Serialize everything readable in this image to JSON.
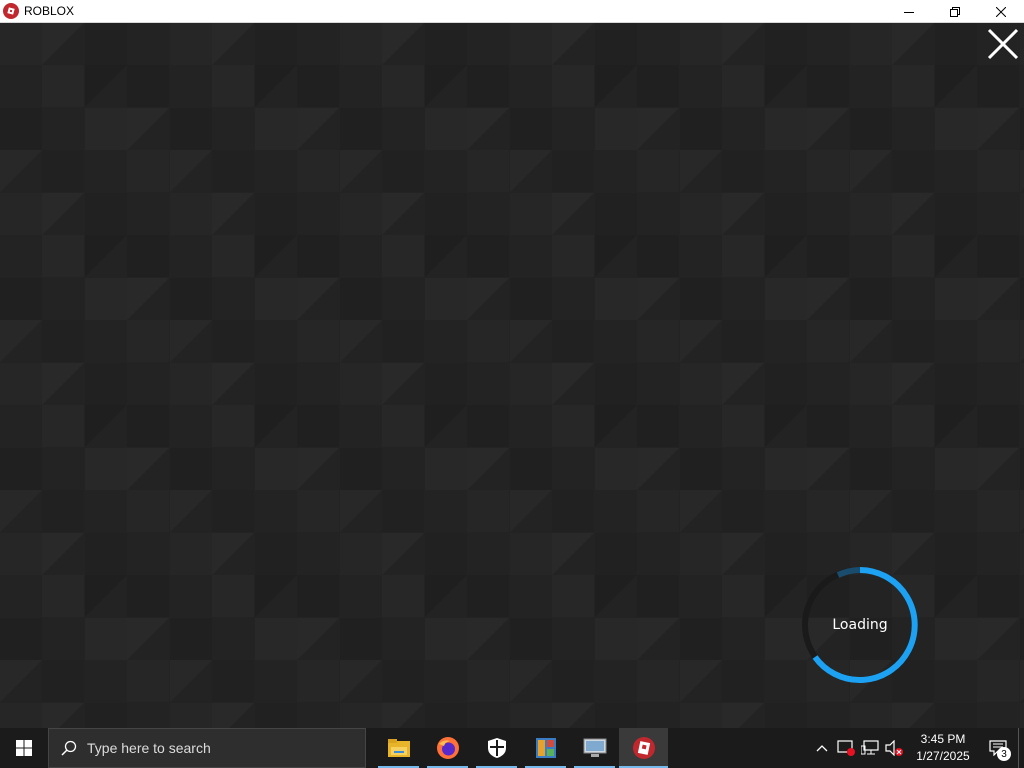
{
  "window": {
    "title": "ROBLOX",
    "icon": "roblox-logo-icon",
    "controls": [
      "minimize-icon",
      "restore-icon",
      "close-icon"
    ]
  },
  "game": {
    "close_icon": "close-x-icon",
    "loading_text": "Loading",
    "spinner_color": "#1da1f2"
  },
  "taskbar": {
    "start_icon": "windows-start-icon",
    "search_placeholder": "Type here to search",
    "apps": [
      {
        "name": "file-explorer-icon",
        "active": false
      },
      {
        "name": "firefox-icon",
        "active": false
      },
      {
        "name": "windows-security-icon",
        "active": false
      },
      {
        "name": "control-panel-icon",
        "active": false
      },
      {
        "name": "remote-desktop-icon",
        "active": false
      },
      {
        "name": "roblox-icon",
        "active": true
      }
    ],
    "tray": {
      "time": "3:45 PM",
      "date": "1/27/2025",
      "notification_count": "3"
    }
  }
}
